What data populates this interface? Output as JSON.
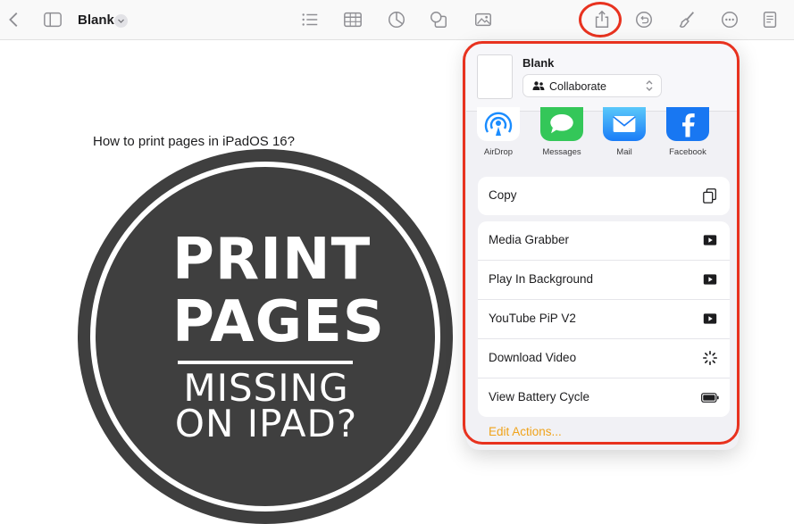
{
  "toolbar": {
    "document_title": "Blank",
    "icons": [
      "chevron-left-icon",
      "sidebar-icon",
      "chevron-down-icon",
      "list-icon",
      "table-icon",
      "chart-icon",
      "shape-icon",
      "media-icon",
      "share-icon",
      "undo-icon",
      "brush-icon",
      "more-icon",
      "document-icon"
    ]
  },
  "canvas": {
    "caption": "How to print pages in iPadOS 16?",
    "graphic": {
      "line1": "PRINT",
      "line2": "PAGES",
      "line3": "MISSING",
      "line4": "ON IPAD?"
    }
  },
  "share_sheet": {
    "title": "Blank",
    "collaborate_label": "Collaborate",
    "apps": [
      {
        "label": "AirDrop",
        "icon": "airdrop-icon"
      },
      {
        "label": "Messages",
        "icon": "messages-icon"
      },
      {
        "label": "Mail",
        "icon": "mail-icon"
      },
      {
        "label": "Facebook",
        "icon": "facebook-icon"
      }
    ],
    "copy_label": "Copy",
    "actions": [
      {
        "label": "Media Grabber",
        "icon": "play-icon"
      },
      {
        "label": "Play In Background",
        "icon": "play-icon"
      },
      {
        "label": "YouTube PiP V2",
        "icon": "play-icon"
      },
      {
        "label": "Download Video",
        "icon": "spinner-icon"
      },
      {
        "label": "View Battery Cycle",
        "icon": "battery-icon"
      }
    ],
    "edit_actions_label": "Edit Actions..."
  },
  "colors": {
    "highlight": "#e8321f",
    "accent": "#f0a31b",
    "graphic_fill": "#3f3f3f"
  }
}
